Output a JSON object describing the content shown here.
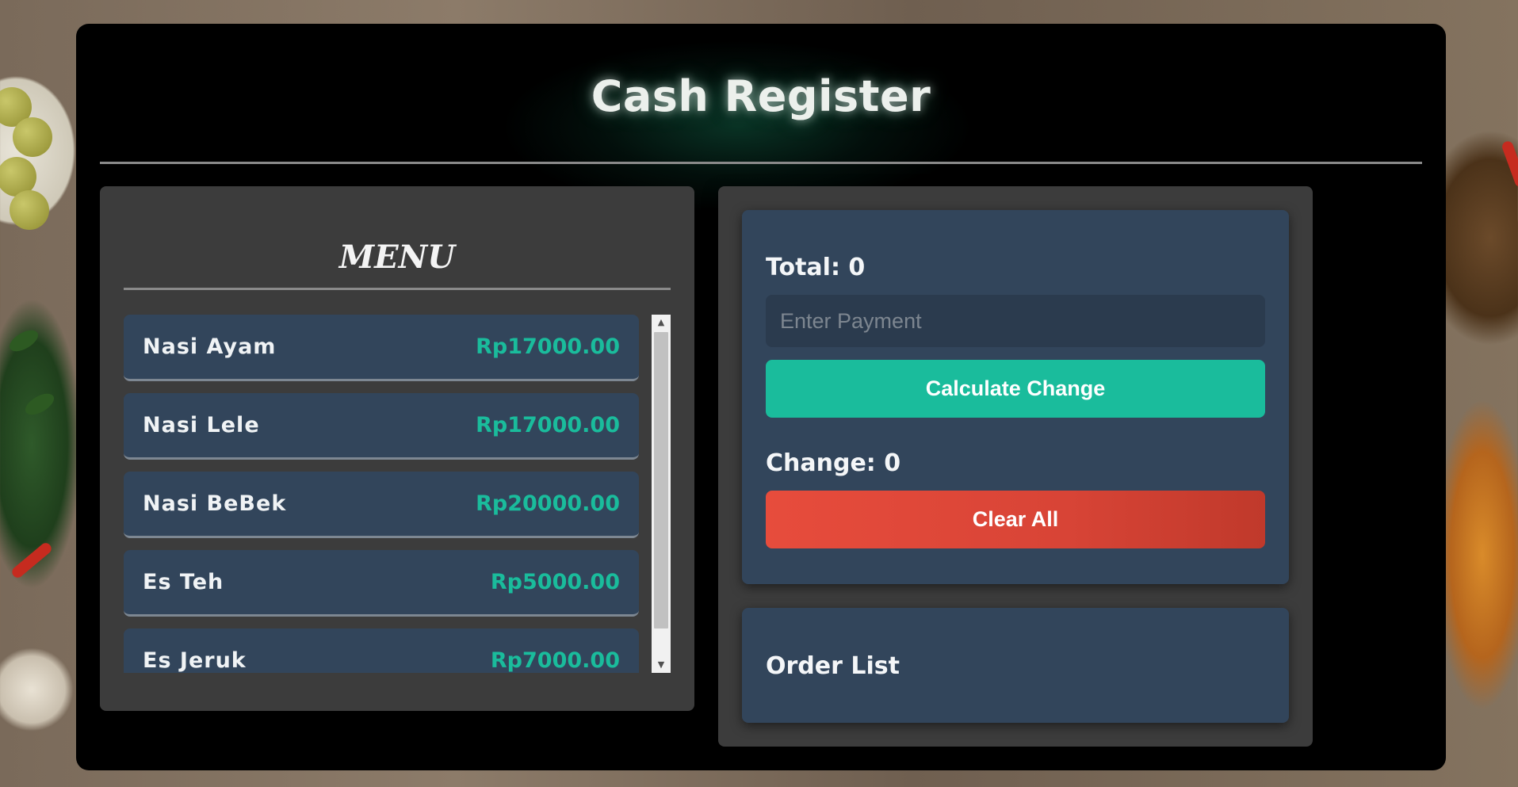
{
  "app": {
    "title": "Cash Register"
  },
  "menu": {
    "heading": "MENU",
    "items": [
      {
        "name": "Nasi Ayam",
        "price": "Rp17000.00"
      },
      {
        "name": "Nasi Lele",
        "price": "Rp17000.00"
      },
      {
        "name": "Nasi BeBek",
        "price": "Rp20000.00"
      },
      {
        "name": "Es Teh",
        "price": "Rp5000.00"
      },
      {
        "name": "Es Jeruk",
        "price": "Rp7000.00"
      }
    ]
  },
  "payment": {
    "total_label": "Total: 0",
    "input_placeholder": "Enter Payment",
    "input_value": "",
    "calculate_label": "Calculate Change",
    "change_label": "Change: 0",
    "clear_label": "Clear All"
  },
  "order": {
    "title": "Order List"
  },
  "colors": {
    "accent": "#1abc9c",
    "danger": "#e74c3c",
    "card": "#32455b",
    "panel": "#3c3c3c"
  },
  "icons": {
    "scroll_up": "triangle-up-icon",
    "scroll_down": "triangle-down-icon"
  }
}
